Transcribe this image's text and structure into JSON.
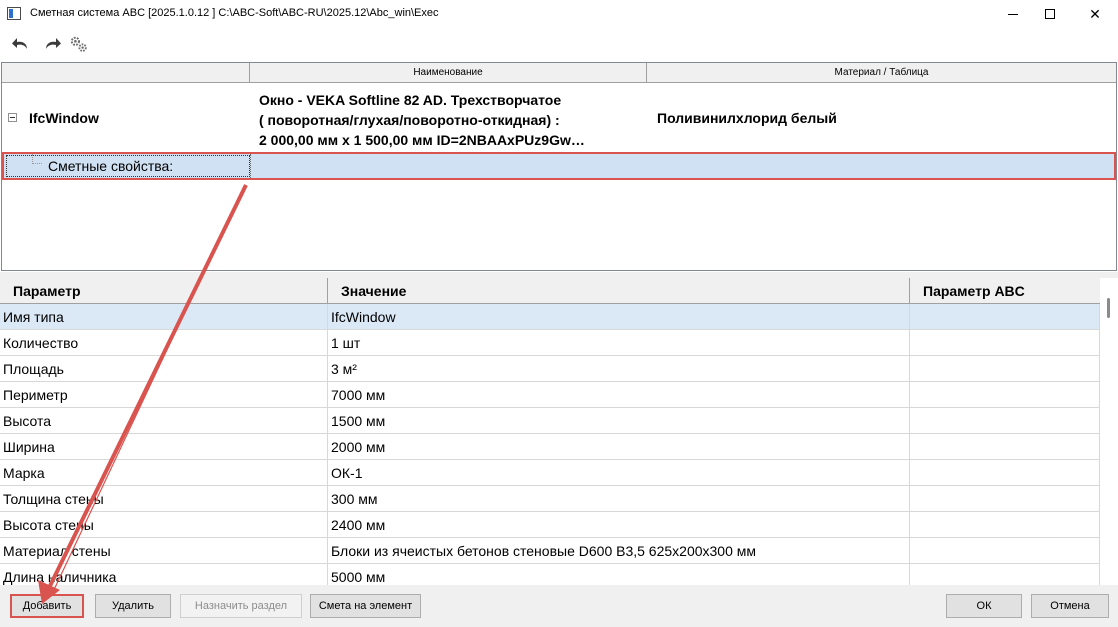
{
  "window": {
    "title": "Сметная система ABC [2025.1.0.12 ]   C:\\ABC-Soft\\ABC-RU\\2025.12\\Abc_win\\Exec",
    "minimize": "",
    "maximize": "",
    "close": "✕"
  },
  "toolbar": {
    "undo_icon": "undo-arrow-icon",
    "redo_icon": "redo-arrow-icon",
    "settings_icon": "gears-icon"
  },
  "tree": {
    "columns": [
      "",
      "Наименование",
      "Материал / Таблица"
    ],
    "node": {
      "name": "IfcWindow",
      "description_lines": [
        "Окно - VEKA Softline 82 AD. Трехстворчатое",
        "( поворотная/глухая/поворотно-откидная)  :",
        "2 000,00 мм x 1 500,00 мм  ID=2NBAAxPUz9Gw…"
      ],
      "material": "Поливинилхлорид белый"
    },
    "child": {
      "name": "Сметные свойства:"
    }
  },
  "props": {
    "columns": [
      "Параметр",
      "Значение",
      "Параметр ABC"
    ],
    "rows": [
      {
        "param": "Имя типа",
        "value": "IfcWindow",
        "abc": ""
      },
      {
        "param": "Количество",
        "value": "1  шт",
        "abc": ""
      },
      {
        "param": "Площадь",
        "value": "3  м²",
        "abc": ""
      },
      {
        "param": "Периметр",
        "value": "7000  мм",
        "abc": ""
      },
      {
        "param": "Высота",
        "value": "1500  мм",
        "abc": ""
      },
      {
        "param": "Ширина",
        "value": "2000  мм",
        "abc": ""
      },
      {
        "param": "Марка",
        "value": "ОК-1",
        "abc": ""
      },
      {
        "param": "Толщина стены",
        "value": "300  мм",
        "abc": ""
      },
      {
        "param": "Высота стены",
        "value": "2400  мм",
        "abc": ""
      },
      {
        "param": "Материал стены",
        "value": "Блоки из ячеистых бетонов стеновые D600 B3,5 625x200x300 мм",
        "abc": ""
      },
      {
        "param": "Длина наличника",
        "value": "5000  мм",
        "abc": ""
      }
    ]
  },
  "buttons": {
    "add": "Добавить",
    "delete": "Удалить",
    "assign_section": "Назначить раздел",
    "estimate": "Смета на элемент",
    "ok": "ОК",
    "cancel": "Отмена"
  },
  "colors": {
    "selection": "#cfe1f3",
    "highlight": "#d9534f"
  }
}
